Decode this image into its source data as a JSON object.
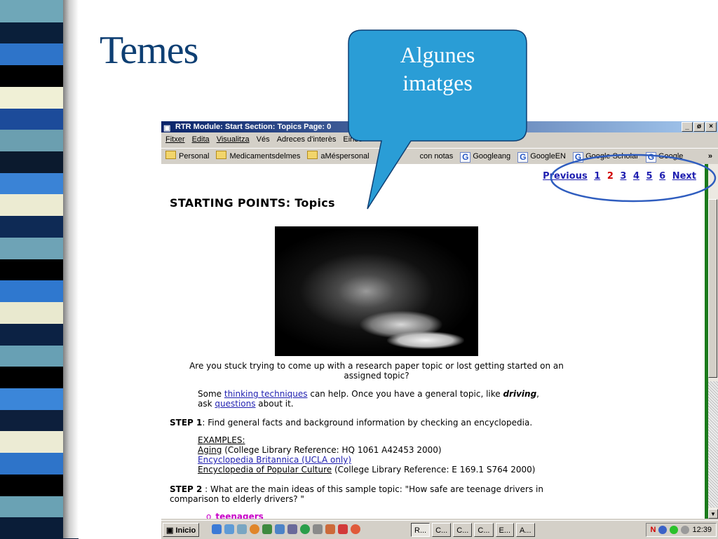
{
  "slide": {
    "title": "Temes",
    "callout": {
      "line1": "Algunes",
      "line2": "imatges"
    },
    "colors": {
      "title": "#0e3f73",
      "callout_fill": "#2a9dd6",
      "callout_border": "#0e3f73",
      "ellipse": "#2f5dbf"
    }
  },
  "strip_colors": [
    "#6fa7b8",
    "#0a1f3a",
    "#2e74c9",
    "#000000",
    "#f0f0d6",
    "#1c4b9a",
    "#6b9fb0",
    "#0b1a2e",
    "#3a83d6",
    "#ecebd2",
    "#0e2a55",
    "#6ea3b6",
    "#000000",
    "#2f78cf",
    "#e9e9cf",
    "#0c2244",
    "#68a0b4",
    "#000000",
    "#3b86d9",
    "#0d1f3c",
    "#ecebd4",
    "#2e74c9",
    "#000000",
    "#6aa2b4",
    "#0a1d38"
  ],
  "browser": {
    "title": "RTR Module: Start Section: Topics Page: 0",
    "window_buttons": [
      "_",
      "ø",
      "×"
    ],
    "menu": [
      "Fitxer",
      "Edita",
      "Visualitza",
      "Vés",
      "Adreces d'interès",
      "Eines"
    ],
    "links": [
      {
        "label": "Personal",
        "icon": "folder-icon"
      },
      {
        "label": "Medicamentsdelmes",
        "icon": "folder-icon"
      },
      {
        "label": "aMéspersonal",
        "icon": "folder-icon"
      },
      {
        "label": "con notas",
        "icon": "page-icon"
      },
      {
        "label": "Googleang",
        "icon": "google-icon"
      },
      {
        "label": "GoogleEN",
        "icon": "google-icon"
      },
      {
        "label": "Google Scholar",
        "icon": "google-icon"
      },
      {
        "label": "Google",
        "icon": "google-icon"
      }
    ],
    "links_more": "»"
  },
  "page": {
    "pager": {
      "previous": "Previous",
      "pages": [
        "1",
        "2",
        "3",
        "4",
        "5",
        "6"
      ],
      "current": "2",
      "next": "Next"
    },
    "heading": "STARTING POINTS: Topics",
    "caption": "Are you stuck trying to come up with a research paper topic or lost getting started on an assigned topic?",
    "tips": {
      "pre": "Some ",
      "link1": "thinking techniques",
      "mid": " can help. Once you have a general topic, like ",
      "emph": "driving",
      "post": ",",
      "ask": "ask ",
      "link2": "questions",
      "end": " about it."
    },
    "step1": {
      "label": "STEP 1",
      "text": ": Find general facts and background information by checking an encyclopedia."
    },
    "examples": {
      "label": "EXAMPLES:",
      "items": [
        {
          "link": "Aging",
          "text": " (College Library Reference: HQ 1061 A42453 2000)"
        },
        {
          "link": "Encyclopedia Britannica (UCLA only)",
          "text": ""
        },
        {
          "link": "Encyclopedia of Popular Culture",
          "text": " (College Library Reference: E 169.1 S764 2000)"
        }
      ]
    },
    "step2": {
      "label": "STEP 2",
      "text": " : What are the main ideas of this sample topic: \"How safe are teenage drivers in comparison to elderly drivers? \""
    },
    "bullet": "teenagers"
  },
  "taskbar": {
    "start": "Inicio",
    "tasks": [
      "R...",
      "C...",
      "C...",
      "C...",
      "E...",
      "A..."
    ],
    "tray_n": "N",
    "clock": "12:39"
  }
}
